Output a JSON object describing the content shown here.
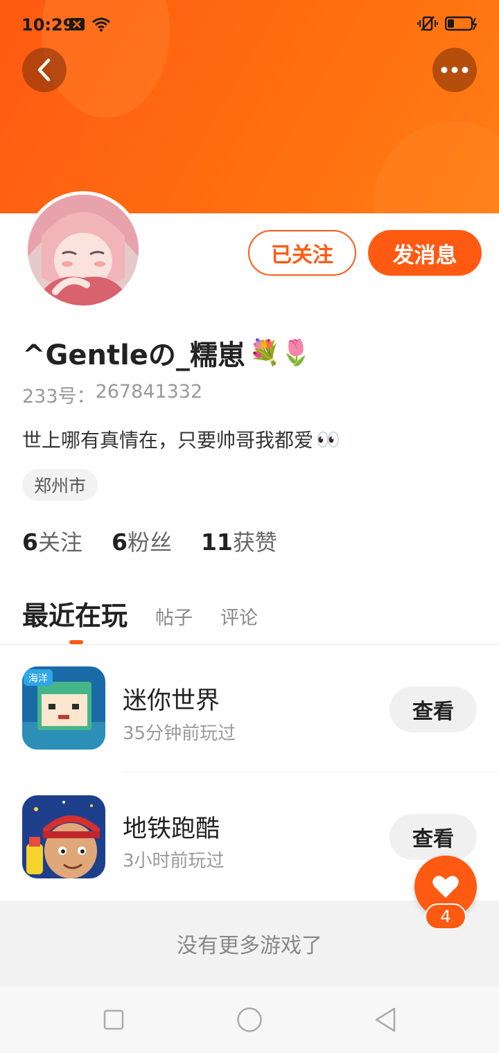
{
  "status_bar": {
    "time": "10:29"
  },
  "header": {
    "back_icon": "chevron-left-icon",
    "more_icon": "more-dots-icon"
  },
  "profile": {
    "follow_label": "已关注",
    "message_label": "发消息",
    "username": "^Gentleの_糯崽",
    "username_emojis": "💐🌷",
    "id_label": "233号：",
    "id_value": "267841332",
    "bio": "世上哪有真情在，只要帅哥我都爱",
    "bio_emoji": "👀",
    "location": "郑州市",
    "stats": [
      {
        "num": "6",
        "label": "关注"
      },
      {
        "num": "6",
        "label": "粉丝"
      },
      {
        "num": "11",
        "label": "获赞"
      }
    ]
  },
  "tabs": {
    "active": "最近在玩",
    "items": [
      "帖子",
      "评论"
    ]
  },
  "games": [
    {
      "name": "迷你世界",
      "time": "35分钟前玩过",
      "button": "查看",
      "icon_badge": "海洋"
    },
    {
      "name": "地铁跑酷",
      "time": "3小时前玩过",
      "button": "查看"
    }
  ],
  "footer": {
    "no_more": "没有更多游戏了"
  },
  "like": {
    "count": "4"
  },
  "colors": {
    "accent": "#ff5a12",
    "header_gradient_end": "#ff7d14"
  }
}
